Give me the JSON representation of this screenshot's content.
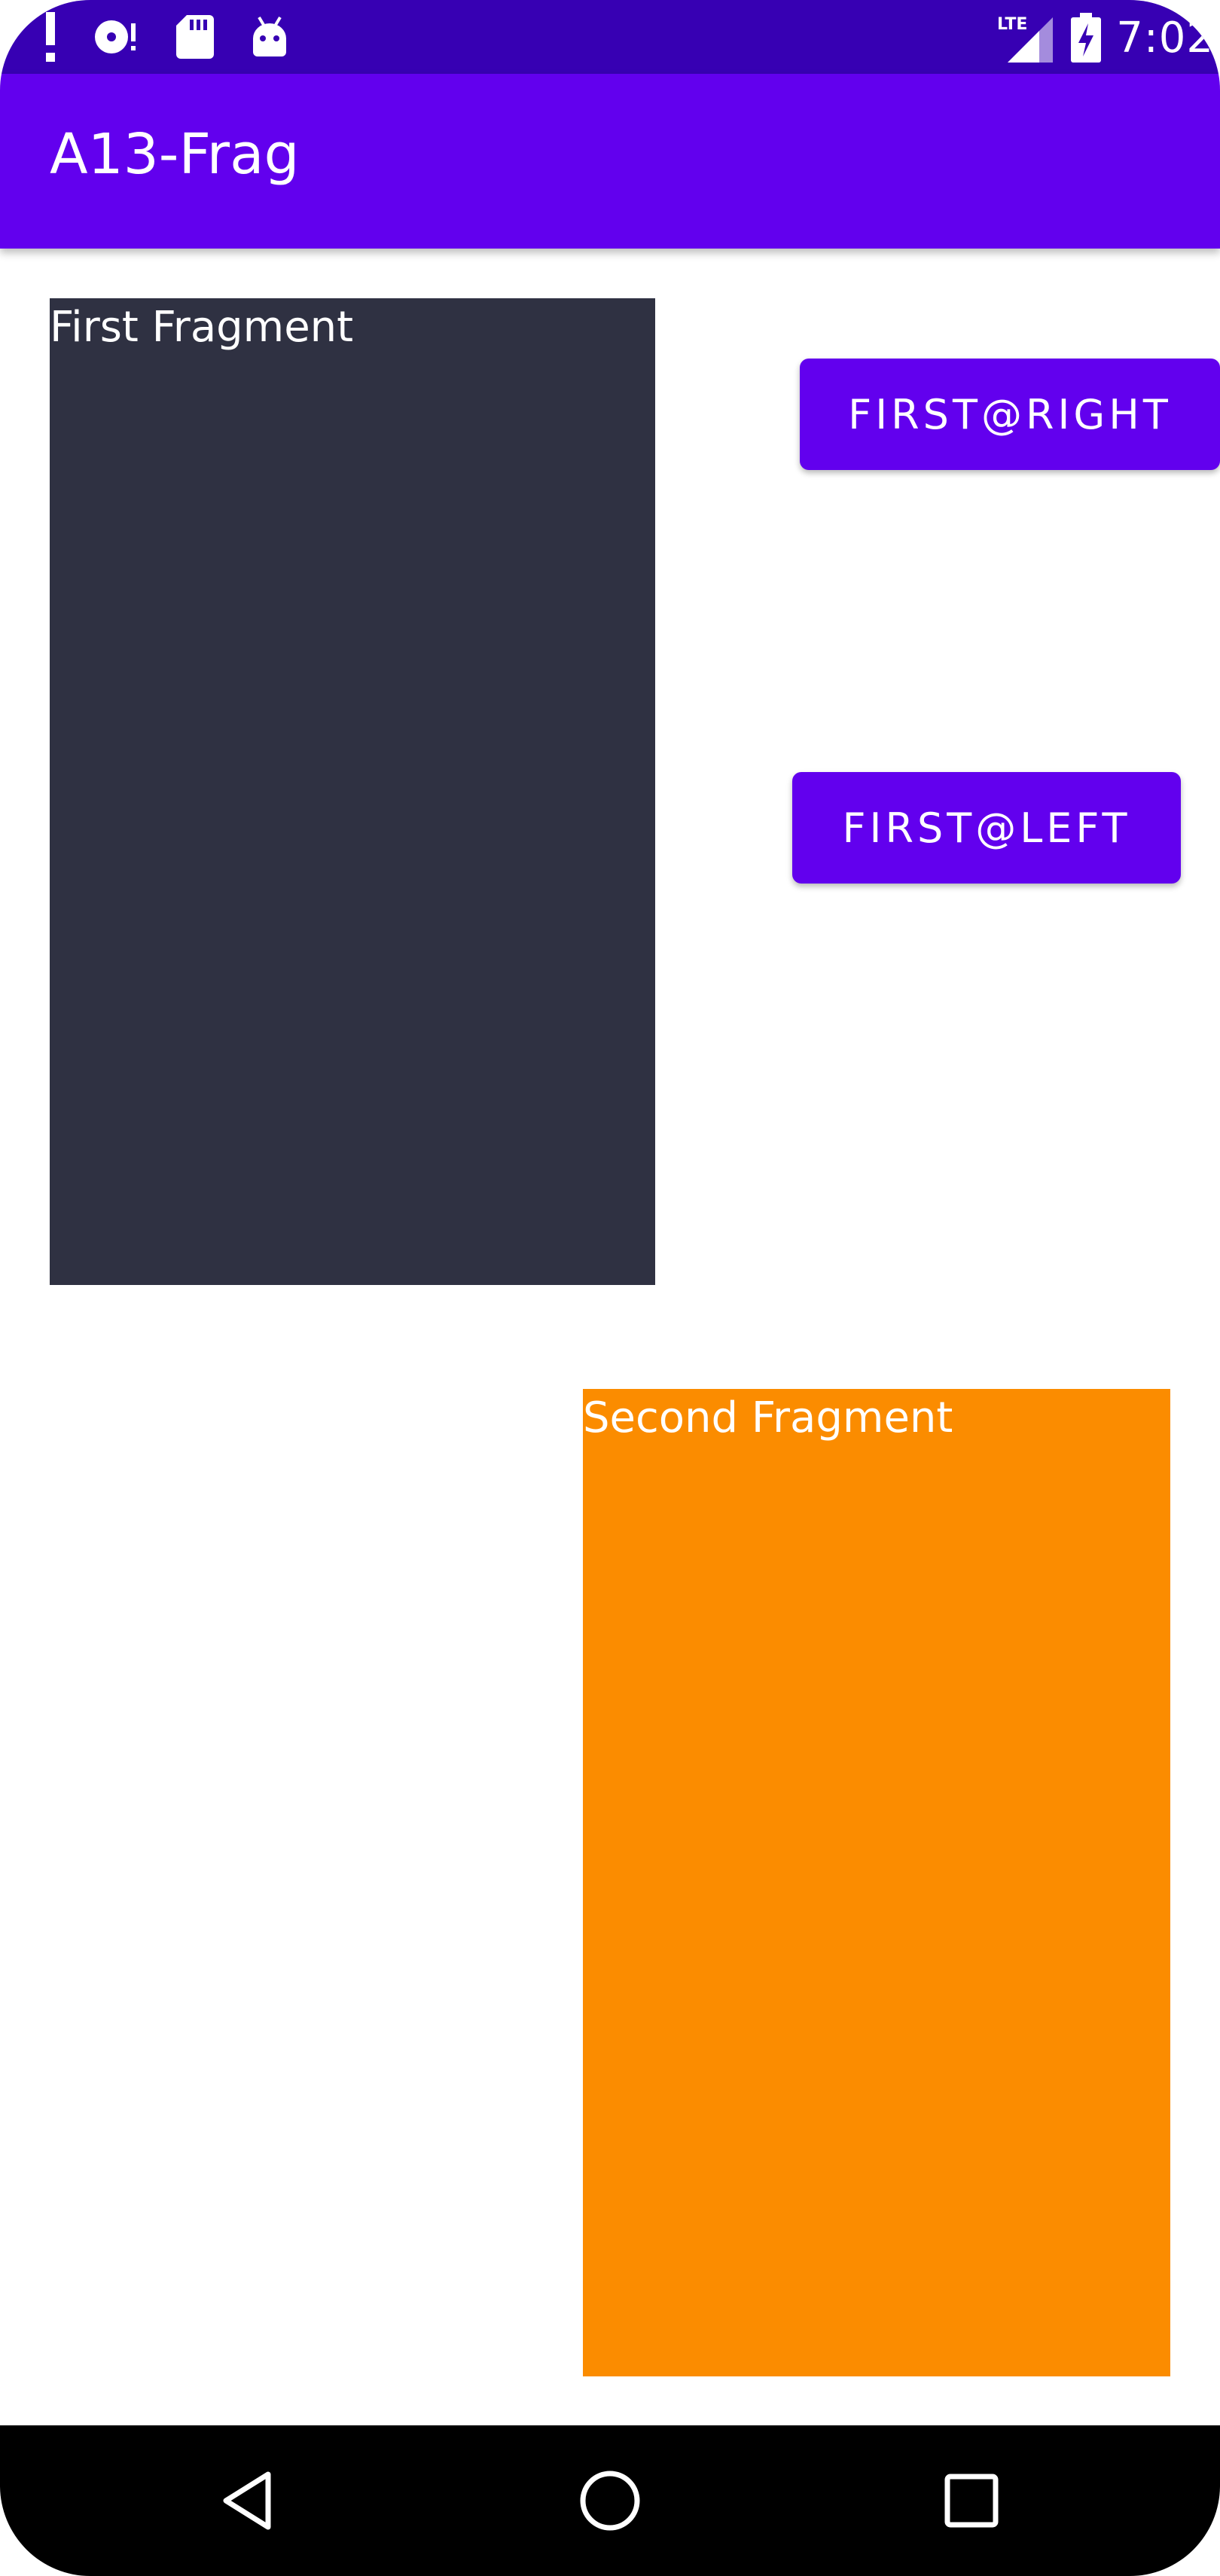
{
  "status_bar": {
    "time": "7:02",
    "network": "LTE",
    "icons": [
      "alert-icon",
      "disc-icon",
      "sd-card-icon",
      "android-icon",
      "signal-icon",
      "battery-charging-icon"
    ]
  },
  "app_bar": {
    "title": "A13-Frag"
  },
  "fragments": {
    "first": {
      "label": "First Fragment",
      "color": "#2F3142"
    },
    "second": {
      "label": "Second Fragment",
      "color": "#FB8C00"
    }
  },
  "buttons": {
    "first_right": "FIRST@RIGHT",
    "first_left": "FIRST@LEFT"
  },
  "colors": {
    "status_bar": "#3700B3",
    "primary": "#6200EE",
    "nav_bar": "#000000"
  },
  "nav_bar": {
    "icons": [
      "back-icon",
      "home-icon",
      "recents-icon"
    ]
  }
}
